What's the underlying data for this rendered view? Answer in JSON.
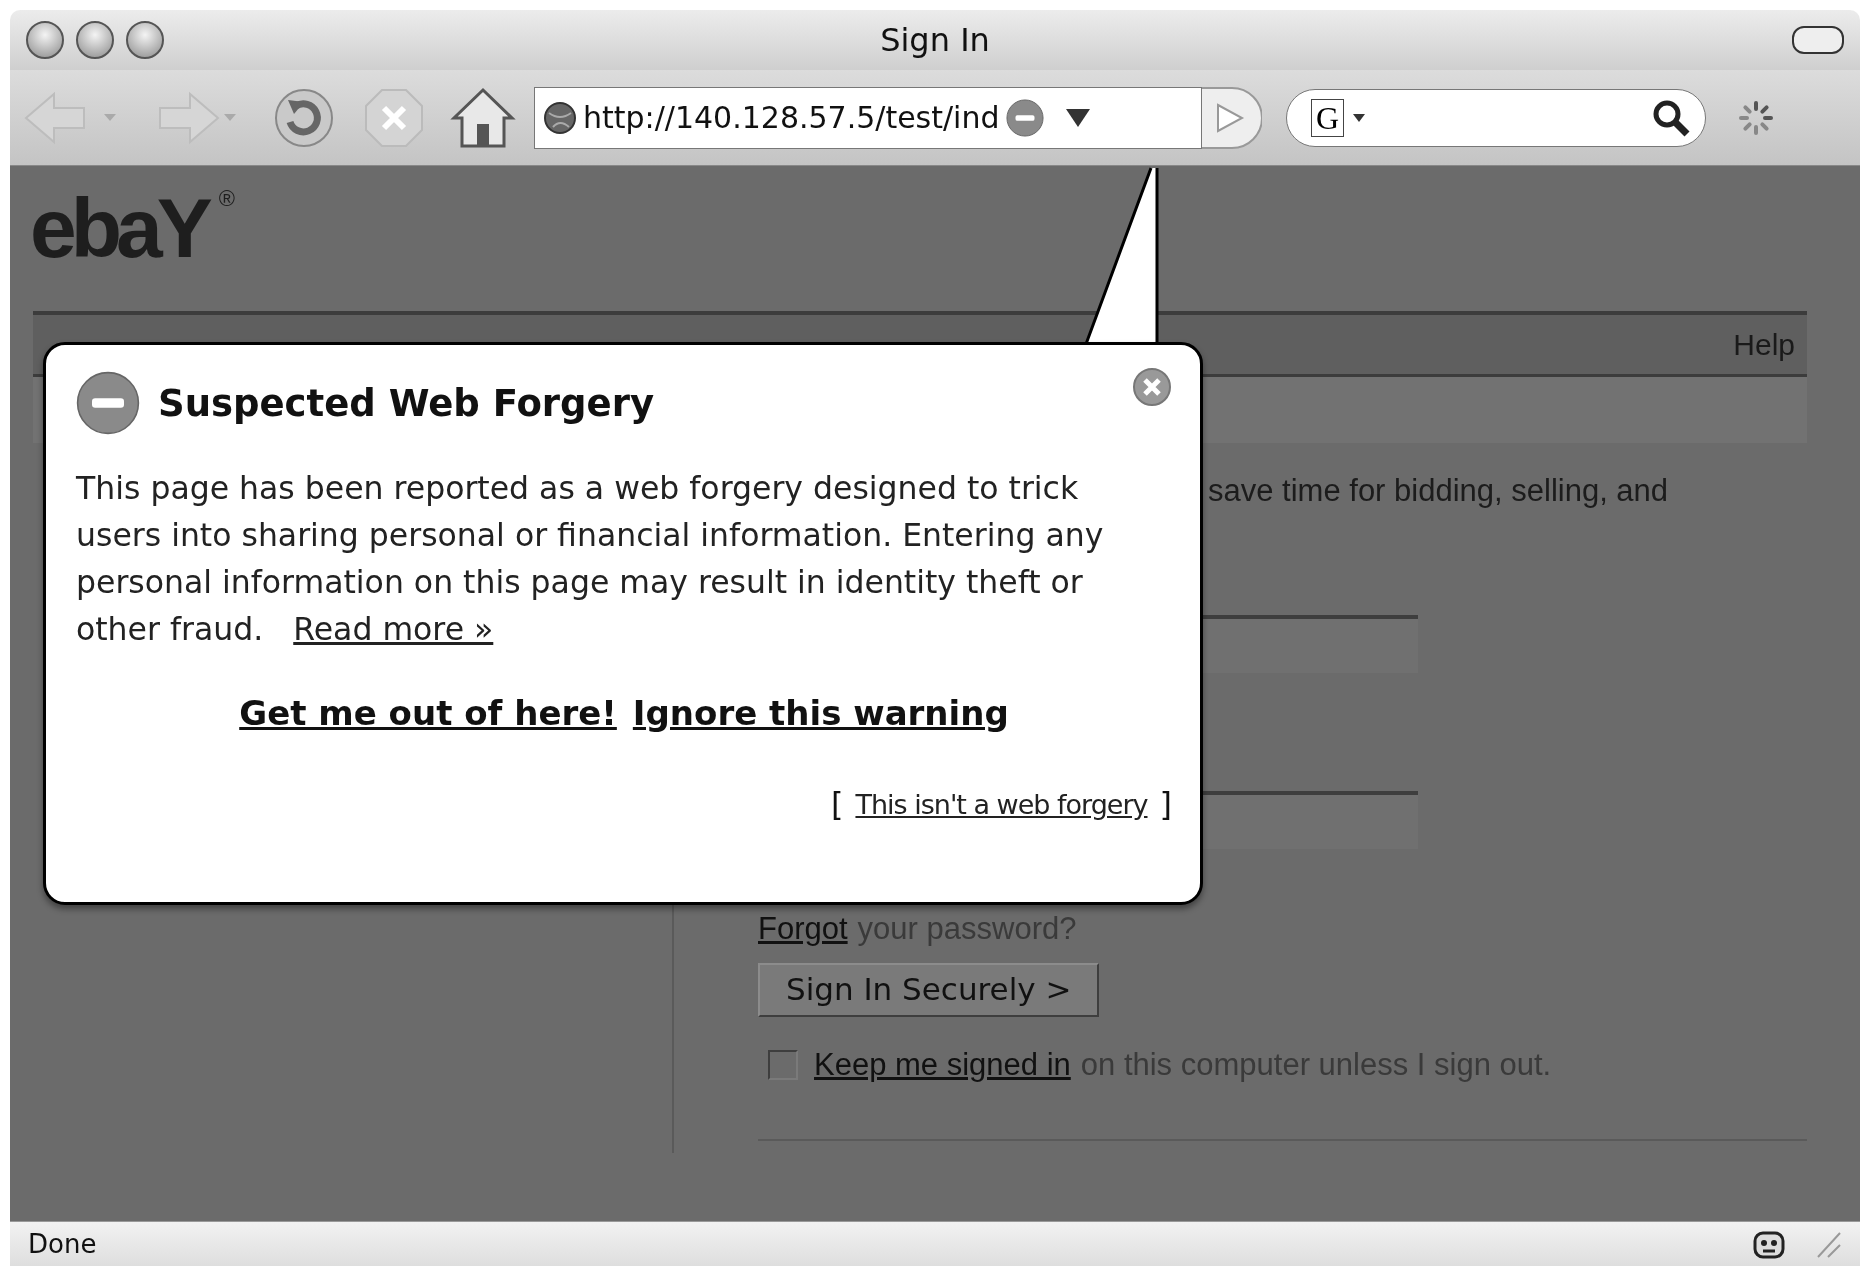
{
  "window": {
    "title": "Sign In"
  },
  "toolbar": {
    "url": "http://140.128.57.5/test/ind",
    "search_engine": "G"
  },
  "page": {
    "logo": {
      "text": "ebaY",
      "mark": "®"
    },
    "header": {
      "help": "Help"
    },
    "intro": "save time for bidding, selling, and",
    "forgot": {
      "link": "Forgot",
      "text": "your password?"
    },
    "submit": "Sign In Securely >",
    "keep_signed_in": {
      "checked": false,
      "link": "Keep me signed in",
      "text": "on this computer unless I sign out."
    }
  },
  "warning": {
    "title": "Suspected Web Forgery",
    "message": "This page has been reported as a web forgery designed to trick users into sharing personal or financial information. Entering any personal information on this page may result in identity theft or other fraud.",
    "read_more": "Read more »",
    "actions": [
      "Get me out of here!",
      "Ignore this warning"
    ],
    "bracket_open": "[",
    "not_forgery": "This isn't a web forgery",
    "bracket_close": "]"
  },
  "status_bar": {
    "text": "Done"
  }
}
